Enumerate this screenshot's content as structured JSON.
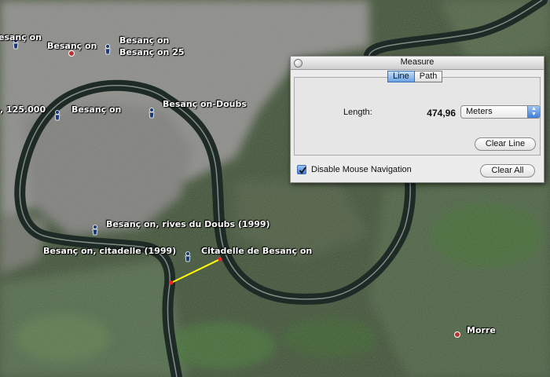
{
  "map": {
    "placemarks": [
      {
        "label": "esanç on"
      },
      {
        "label": "Besanç on"
      },
      {
        "label": "Besanç on"
      },
      {
        "label": "Besanç on 25"
      },
      {
        "label": ", 125.000"
      },
      {
        "label": "Besanç on"
      },
      {
        "label": "Besanç on-Doubs"
      },
      {
        "label": "Besanç on, rives du Doubs (1999)"
      },
      {
        "label": "Besanç on, citadelle (1999)"
      },
      {
        "label": "Citadelle de Besanç on"
      },
      {
        "label": "Morre"
      }
    ],
    "colors": {
      "measure_line": "#ffff00",
      "endpoint": "#ff2020",
      "river": "#1e2a26"
    }
  },
  "measure": {
    "title": "Measure",
    "tabs": [
      {
        "label": "Line",
        "active": true
      },
      {
        "label": "Path",
        "active": false
      }
    ],
    "length_label": "Length:",
    "length_value": "474,96",
    "unit_selected": "Meters",
    "clear_line_label": "Clear Line",
    "disable_nav_label": "Disable Mouse Navigation",
    "disable_nav_checked": true,
    "clear_all_label": "Clear All"
  }
}
